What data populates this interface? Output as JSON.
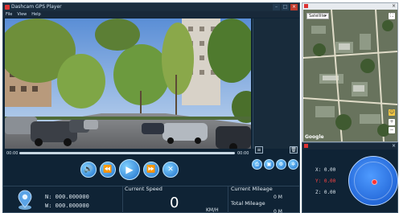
{
  "player": {
    "title": "Dashcam GPS Player",
    "menu": [
      "File",
      "View",
      "Help"
    ],
    "time_start": "00:00",
    "time_end": "00:00",
    "progress": 0.0
  },
  "controls": {
    "icons": [
      "volume-icon",
      "rewind-icon",
      "play-icon",
      "fast-forward-icon",
      "stop-icon"
    ],
    "tools": [
      "export-icon",
      "snapshot-icon",
      "settings-icon",
      "network-icon"
    ]
  },
  "info": {
    "north": "N:  000.000000",
    "west": "W:  000.000000",
    "speed_label": "Current Speed",
    "speed_value": "0",
    "speed_unit": "KM/H",
    "mileage_label": "Current Mileage",
    "mileage_value": "0  M",
    "total_label": "Total Mileage",
    "total_value": "0  M"
  },
  "map": {
    "select_value": "Satellite",
    "google": "Google"
  },
  "gyro": {
    "x": "X:  0.00",
    "y": "Y:  0.00",
    "z": "Z:  0.00"
  },
  "colors": {
    "panel_bg": "#0f2335",
    "accent_blue": "#1e6fc9",
    "warn_red": "#ff4545"
  }
}
